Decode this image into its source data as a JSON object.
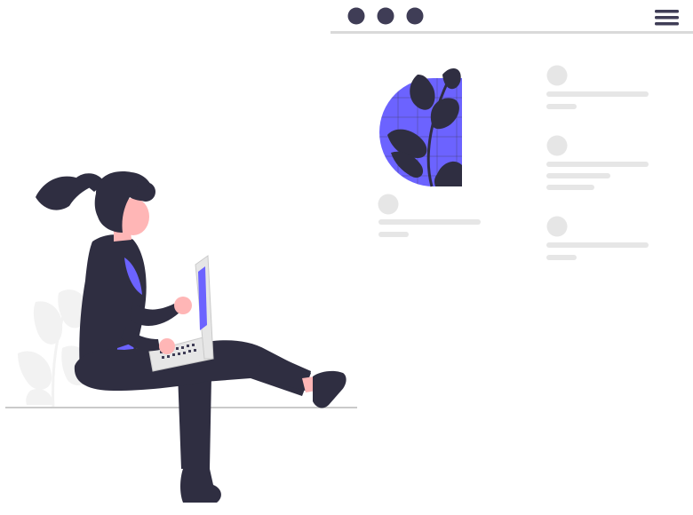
{
  "colors": {
    "background": "#ffffff",
    "dark": "#3f3d56",
    "ink": "#2f2e41",
    "accent": "#6c63ff",
    "placeholder_light": "#e6e6e6",
    "placeholder_dark": "#d9d9d9",
    "plant_shadow": "#f2f2f2",
    "skin": "#ffb6b6",
    "laptop_light": "#e6e6e6",
    "laptop_screen": "#6c63ff"
  },
  "browser": {
    "window_dots": [
      "dot-1",
      "dot-2",
      "dot-3"
    ],
    "menu_icon": "hamburger-menu-icon"
  },
  "content": {
    "feature_image": "plant-illustration-icon",
    "text_blocks": [
      {
        "name": "card-left",
        "lines": 2
      },
      {
        "name": "list-item-1",
        "lines": 2
      },
      {
        "name": "list-item-2",
        "lines": 3
      },
      {
        "name": "list-item-3",
        "lines": 2
      }
    ]
  },
  "illustration": {
    "subject": "woman-with-laptop-illustration",
    "foliage": "background-plant-icon"
  }
}
